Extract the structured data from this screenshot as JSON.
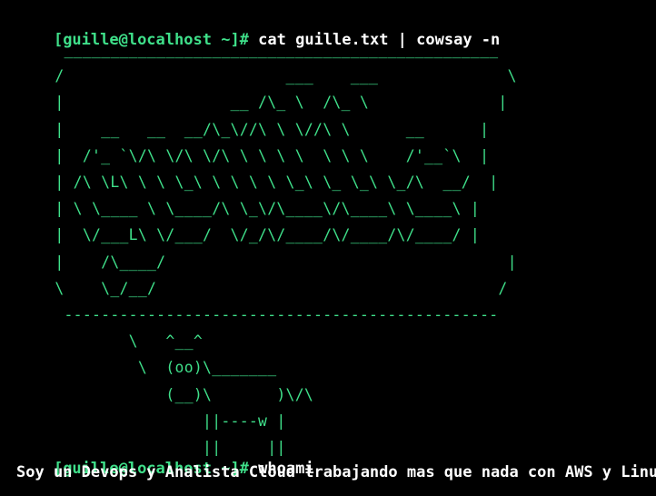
{
  "terminal": {
    "colors": {
      "background": "#000000",
      "prompt": "#3fe08a",
      "text": "#ffffff",
      "art": "#3fe08a"
    },
    "prompt1": {
      "user": "[guille@localhost ",
      "dir": "~",
      "suffix": "]#",
      "command": " cat guille.txt | cowsay -n"
    },
    "cowsay_output": "   _______________________________________________\n  /                        ___    ___              \\\n  |                  __ /\\_ \\  /\\_ \\              |\n  |    __   __  __/\\_\\//\\ \\ \\//\\ \\      __      |\n  |  /'_ `\\/\\ \\/\\ \\/\\ \\ \\ \\ \\  \\ \\ \\    /'__`\\  |\n  | /\\ \\L\\ \\ \\ \\_\\ \\ \\ \\ \\ \\_\\ \\_ \\_\\ \\_/\\  __/  |\n  | \\ \\____ \\ \\____/\\ \\_\\/\\____\\/\\____\\ \\____\\ |\n  |  \\/___L\\ \\/___/  \\/_/\\/____/\\/____/\\/____/ |\n  |    /\\____/                                     |\n  \\    \\_/__/                                     /\n   -----------------------------------------------\n          \\   ^__^\n           \\  (oo)\\_______\n              (__)\\       )\\/\\\n                  ||----w |\n                  ||     ||",
    "prompt2": {
      "user": "[guille@localhost ",
      "dir": "~",
      "suffix": "]#",
      "command": " whoami"
    },
    "output": "Soy un Devops y Analista Cloud trabajando mas que nada con AWS y Linux"
  }
}
